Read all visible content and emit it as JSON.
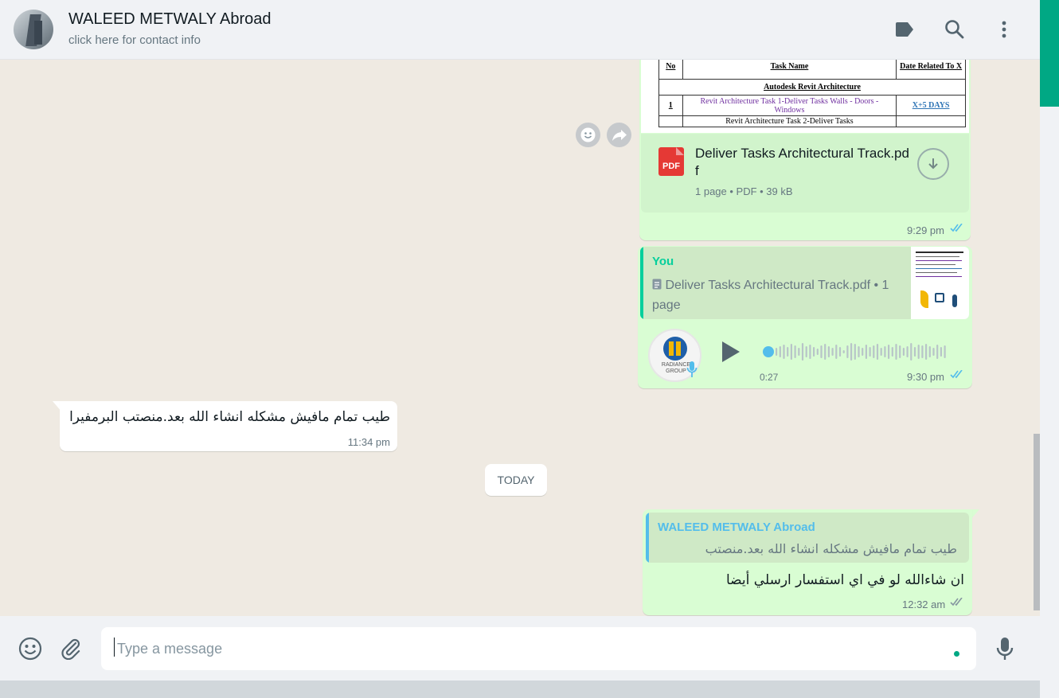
{
  "header": {
    "contact_name": "WALEED METWALY Abroad",
    "contact_sub": "click here for contact info",
    "icons": [
      "label-icon",
      "search-icon",
      "menu-icon"
    ]
  },
  "document_message": {
    "preview_rows": [
      {
        "no": "No",
        "task": "Task Name",
        "date": "Date Related To X"
      },
      {
        "section": "Autodesk Revit Architecture"
      },
      {
        "no": "1",
        "task": "Revit Architecture Task 1-Deliver Tasks Walls - Doors - Windows",
        "date": "X+5 DAYS"
      },
      {
        "no": "",
        "task": "Revit Architecture Task 2-Deliver Tasks",
        "date": ""
      }
    ],
    "file_type_badge": "PDF",
    "file_name": "Deliver Tasks Architectural Track.pdf",
    "file_info": "1 page • PDF • 39 kB",
    "time": "9:29 pm",
    "status": "read"
  },
  "voice_message": {
    "quote_author": "You",
    "quote_text": "Deliver Tasks Architectural Track.pdf • 1 page",
    "avatar_text": "RADIANCE GROUP",
    "duration": "0:27",
    "time": "9:30 pm",
    "status": "read"
  },
  "incoming_message": {
    "text": "طيب تمام مافيش مشكله انشاء الله بعد.منصتب البرمفيرا",
    "time": "11:34 pm"
  },
  "date_divider": "TODAY",
  "reply_message": {
    "quote_author": "WALEED METWALY Abroad",
    "quote_text": "طيب تمام مافيش مشكله انشاء الله بعد.منصتب البرمفيرا",
    "text": "ان شاءالله لو في اي استفسار ارسلي أيضا",
    "time": "12:32 am",
    "status": "delivered"
  },
  "composer": {
    "placeholder": "Type a message",
    "value": ""
  },
  "colors": {
    "accent": "#00a884",
    "outgoing_bubble": "#d9fdd3",
    "read_ticks": "#53bdeb",
    "quote_you": "#06cf9c",
    "quote_contact": "#53bdeb"
  }
}
